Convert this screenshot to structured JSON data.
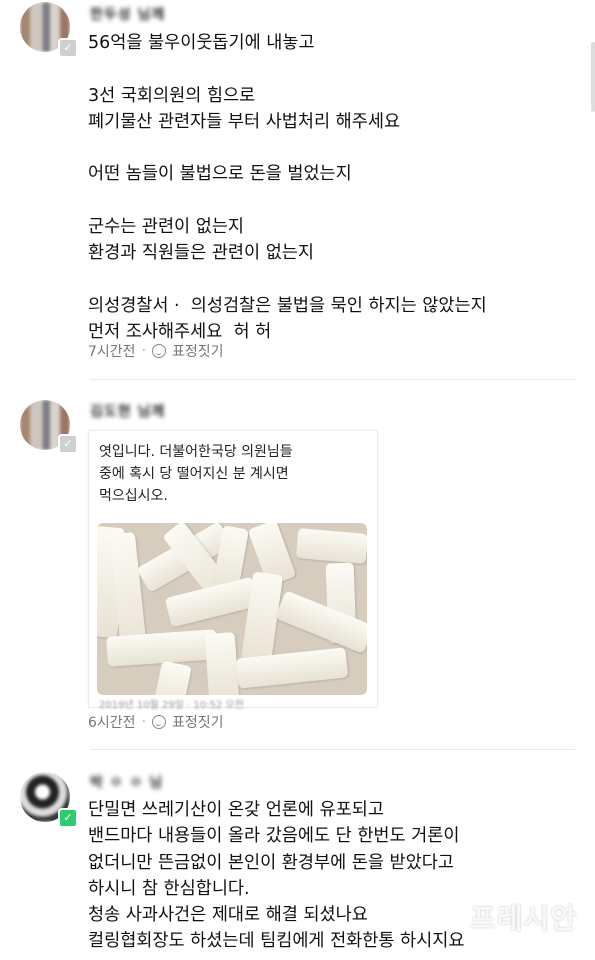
{
  "comments": [
    {
      "author": "한두성 님께",
      "lines": "56억을 불우이웃돕기에 내놓고\n\n3선 국회의원의 힘으로\n폐기물산 관련자들 부터 사법처리 해주세요\n\n어떤 놈들이 불법으로 돈을 벌었는지\n\n군수는 관련이 없는지\n환경과 직원들은 관련이 없는지\n\n의성경찰서 ·  의성검찰은 불법을 묵인 하지는 않았는지\n먼저 조사해주세요  허 허",
      "time": "7시간전",
      "react": "표정짓기"
    },
    {
      "author": "김도현 님께",
      "card_text": "엿입니다. 더불어한국당 의원님들\n중에 혹시 당 떨어지신 분 계시면\n먹으십시오.",
      "card_date": "2019년 10월 29일 · 10:52 오전",
      "time": "6시간전",
      "react": "표정짓기"
    },
    {
      "author": "박 ㅇ ㅇ 님",
      "lines": "단밀면 쓰레기산이 온갖 언론에 유포되고\n밴드마다 내용들이 올라 갔음에도 단 한번도 거론이\n없더니만 뜬금없이 본인이 환경부에 돈을 받았다고\n하시니 참 한심합니다.\n청송 사과사건은 제대로 해결 되셨나요\n컬링협회장도 하셨는데 팀킴에게 전화한통 하시지요"
    }
  ],
  "watermark": "프레시안"
}
